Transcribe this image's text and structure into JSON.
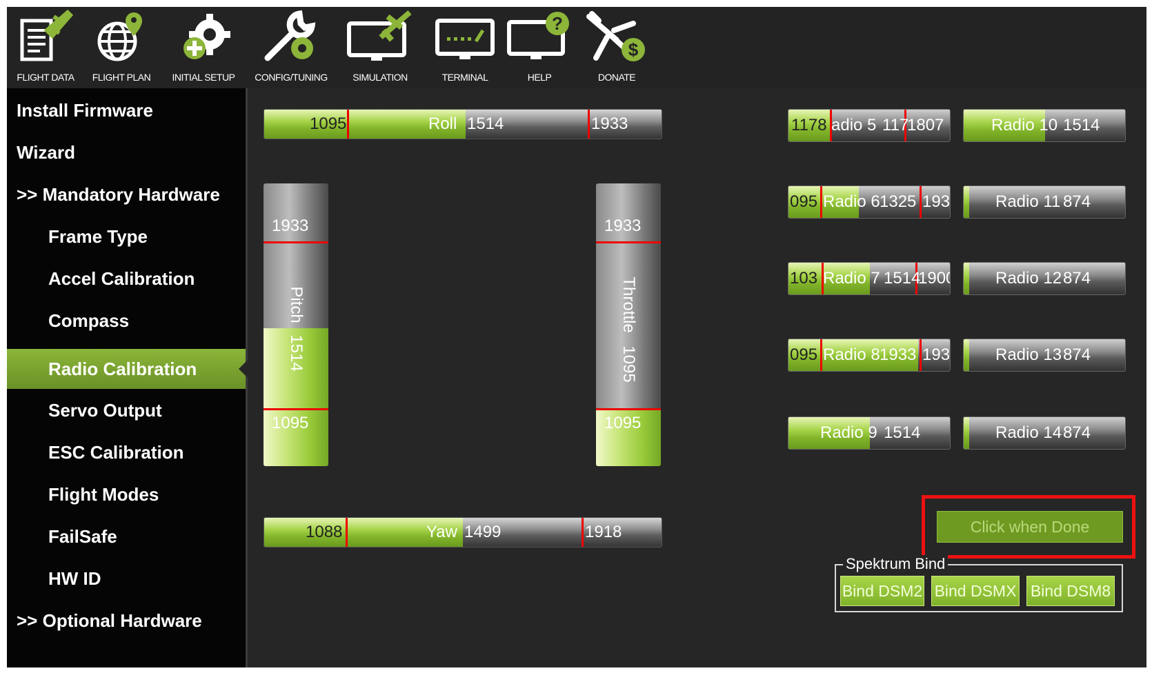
{
  "toolbar": {
    "items": [
      {
        "label": "FLIGHT DATA",
        "icon": "clipboard-plane-icon"
      },
      {
        "label": "FLIGHT PLAN",
        "icon": "globe-pin-icon"
      },
      {
        "label": "INITIAL SETUP",
        "icon": "gear-plus-icon"
      },
      {
        "label": "CONFIG/TUNING",
        "icon": "wrench-gear-icon"
      },
      {
        "label": "SIMULATION",
        "icon": "monitor-plane-icon"
      },
      {
        "label": "TERMINAL",
        "icon": "terminal-monitor-icon"
      },
      {
        "label": "HELP",
        "icon": "monitor-question-icon"
      },
      {
        "label": "DONATE",
        "icon": "plane-dollar-icon"
      }
    ]
  },
  "sidebar": {
    "items": [
      {
        "label": "Install Firmware"
      },
      {
        "label": "Wizard"
      },
      {
        "label": ">> Mandatory Hardware"
      },
      {
        "label": "Frame Type"
      },
      {
        "label": "Accel Calibration"
      },
      {
        "label": "Compass"
      },
      {
        "label": "Radio Calibration",
        "active": true
      },
      {
        "label": "Servo Output"
      },
      {
        "label": "ESC Calibration"
      },
      {
        "label": "Flight Modes"
      },
      {
        "label": "FailSafe"
      },
      {
        "label": "HW ID"
      },
      {
        "label": ">> Optional Hardware"
      }
    ]
  },
  "channels": {
    "roll": {
      "name": "Roll",
      "min": "1095",
      "value": "1514",
      "max": "1933"
    },
    "pitch": {
      "name": "Pitch",
      "min": "1095",
      "value": "1514",
      "max": "1933"
    },
    "throttle": {
      "name": "Throttle",
      "min": "1095",
      "value": "1095",
      "max": "1933"
    },
    "yaw": {
      "name": "Yaw",
      "min": "1088",
      "value": "1499",
      "max": "1918"
    }
  },
  "radios": {
    "r5": {
      "name": "Radio 5",
      "value": "1178",
      "min": "1178",
      "max": "1807",
      "label_shown": "adio 5",
      "value_shown": "117",
      "min_shown": "1178",
      "max_shown": "1807"
    },
    "r6": {
      "name": "Radio 6",
      "value": "1325",
      "min_shown": "095",
      "max_shown": "193",
      "label_shown": "Radio 6"
    },
    "r7": {
      "name": "Radio 7",
      "value": "1514",
      "min_shown": "103",
      "max_shown": "1900",
      "label_shown": "Radio 7"
    },
    "r8": {
      "name": "Radio 8",
      "value": "1933",
      "min_shown": "095",
      "max_shown": "193",
      "label_shown": "Radio 8"
    },
    "r9": {
      "name": "Radio 9",
      "value": "1514"
    },
    "r10": {
      "name": "Radio 10",
      "value": "1514"
    },
    "r11": {
      "name": "Radio 11",
      "value": "874"
    },
    "r12": {
      "name": "Radio 12",
      "value": "874"
    },
    "r13": {
      "name": "Radio 13",
      "value": "874"
    },
    "r14": {
      "name": "Radio 14",
      "value": "874"
    }
  },
  "done_button": "Click when Done",
  "spektrum": {
    "legend": "Spektrum Bind",
    "buttons": [
      "Bind DSM2",
      "Bind DSMX",
      "Bind DSM8"
    ]
  },
  "colors": {
    "accent_green": "#8cb53a",
    "marker_red": "#e00000",
    "highlight_red": "#e11111"
  }
}
